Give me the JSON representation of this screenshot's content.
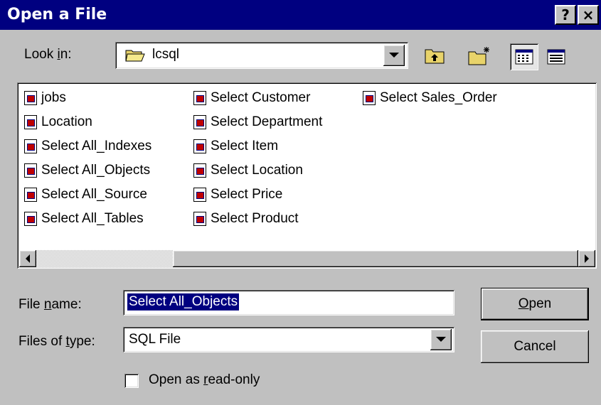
{
  "window": {
    "title": "Open a File",
    "help_button": "?",
    "close_button": "×"
  },
  "look_in": {
    "label_prefix": "Look ",
    "label_underlined": "i",
    "label_suffix": "n:",
    "value": "lcsql",
    "icon": "folder-icon"
  },
  "toolbar": {
    "up_folder": "up-folder-icon",
    "new_folder": "new-folder-icon",
    "list_view": "list-view-icon",
    "details_view": "details-view-icon"
  },
  "files": [
    {
      "name": "jobs"
    },
    {
      "name": "Location"
    },
    {
      "name": "Select All_Indexes"
    },
    {
      "name": "Select All_Objects"
    },
    {
      "name": "Select All_Source"
    },
    {
      "name": "Select All_Tables"
    },
    {
      "name": "Select Customer"
    },
    {
      "name": "Select Department"
    },
    {
      "name": "Select Item"
    },
    {
      "name": "Select Location"
    },
    {
      "name": "Select Price"
    },
    {
      "name": "Select Product"
    },
    {
      "name": "Select Sales_Order"
    }
  ],
  "file_name": {
    "label_prefix": "File ",
    "label_underlined": "n",
    "label_suffix": "ame:",
    "value": "Select All_Objects"
  },
  "files_of_type": {
    "label_prefix": "Files of ",
    "label_underlined": "t",
    "label_suffix": "ype:",
    "value": "SQL File"
  },
  "buttons": {
    "open_underlined": "O",
    "open_rest": "pen",
    "cancel": "Cancel"
  },
  "read_only": {
    "label_prefix": "Open as ",
    "label_underlined": "r",
    "label_suffix": "ead-only",
    "checked": false
  }
}
